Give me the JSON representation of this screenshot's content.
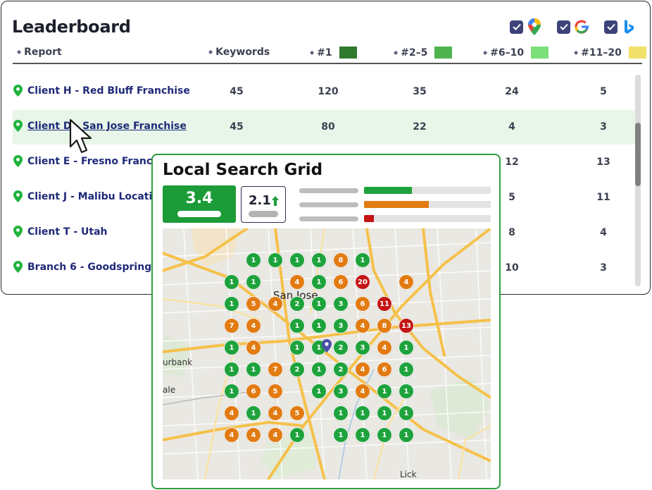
{
  "leaderboard": {
    "title": "Leaderboard",
    "sources": [
      {
        "name": "google-maps",
        "checked": true
      },
      {
        "name": "google",
        "checked": true
      },
      {
        "name": "bing",
        "checked": true
      }
    ],
    "columns": [
      {
        "label": "Report"
      },
      {
        "label": "Keywords"
      },
      {
        "label": "#1",
        "swatch": "#2f7a2f"
      },
      {
        "label": "#2–5",
        "swatch": "#4fb44f"
      },
      {
        "label": "#6–10",
        "swatch": "#7ddf79"
      },
      {
        "label": "#11–20",
        "swatch": "#f2e16b"
      }
    ],
    "rows": [
      {
        "name": "Client H - Red Bluff Franchise",
        "keywords": "45",
        "r1": "120",
        "r2_5": "35",
        "r6_10": "24",
        "r11_20": "5",
        "highlighted": false
      },
      {
        "name": "Client D - San Jose Franchise",
        "keywords": "45",
        "r1": "80",
        "r2_5": "22",
        "r6_10": "4",
        "r11_20": "3",
        "highlighted": true
      },
      {
        "name": "Client E - Fresno Franchise",
        "keywords": "",
        "r1": "",
        "r2_5": "",
        "r6_10": "12",
        "r11_20": "13",
        "highlighted": false
      },
      {
        "name": "Client J - Malibu Location",
        "keywords": "",
        "r1": "",
        "r2_5": "",
        "r6_10": "5",
        "r11_20": "11",
        "highlighted": false
      },
      {
        "name": "Client T - Utah",
        "keywords": "",
        "r1": "",
        "r2_5": "",
        "r6_10": "8",
        "r11_20": "4",
        "highlighted": false
      },
      {
        "name": "Branch 6 - Goodspring",
        "keywords": "",
        "r1": "",
        "r2_5": "",
        "r6_10": "10",
        "r11_20": "3",
        "highlighted": false
      }
    ]
  },
  "grid": {
    "title": "Local Search Grid",
    "score": "3.4",
    "score_secondary": "2.1",
    "trend": "up",
    "distribution": [
      {
        "fill": 0.38,
        "color": "#1ea33c"
      },
      {
        "fill": 0.51,
        "color": "#e27b12"
      },
      {
        "fill": 0.08,
        "color": "#c41414"
      }
    ],
    "map_labels": {
      "city": "San Jose",
      "west": "urbank",
      "west2": "ale",
      "south": "Lick"
    },
    "dots": [
      {
        "row": 0,
        "col": 1,
        "v": "1",
        "c": "g"
      },
      {
        "row": 0,
        "col": 2,
        "v": "1",
        "c": "g"
      },
      {
        "row": 0,
        "col": 3,
        "v": "1",
        "c": "g"
      },
      {
        "row": 0,
        "col": 4,
        "v": "1",
        "c": "g"
      },
      {
        "row": 0,
        "col": 5,
        "v": "8",
        "c": "o"
      },
      {
        "row": 0,
        "col": 6,
        "v": "1",
        "c": "g"
      },
      {
        "row": 1,
        "col": 0,
        "v": "1",
        "c": "g"
      },
      {
        "row": 1,
        "col": 1,
        "v": "1",
        "c": "g"
      },
      {
        "row": 1,
        "col": 3,
        "v": "4",
        "c": "o"
      },
      {
        "row": 1,
        "col": 4,
        "v": "1",
        "c": "g"
      },
      {
        "row": 1,
        "col": 5,
        "v": "6",
        "c": "o"
      },
      {
        "row": 1,
        "col": 6,
        "v": "20",
        "c": "r"
      },
      {
        "row": 1,
        "col": 8,
        "v": "4",
        "c": "o"
      },
      {
        "row": 2,
        "col": 0,
        "v": "1",
        "c": "g"
      },
      {
        "row": 2,
        "col": 1,
        "v": "5",
        "c": "o"
      },
      {
        "row": 2,
        "col": 2,
        "v": "4",
        "c": "o"
      },
      {
        "row": 2,
        "col": 3,
        "v": "2",
        "c": "g"
      },
      {
        "row": 2,
        "col": 4,
        "v": "1",
        "c": "g"
      },
      {
        "row": 2,
        "col": 5,
        "v": "3",
        "c": "g"
      },
      {
        "row": 2,
        "col": 6,
        "v": "6",
        "c": "o"
      },
      {
        "row": 2,
        "col": 7,
        "v": "11",
        "c": "r"
      },
      {
        "row": 3,
        "col": 0,
        "v": "7",
        "c": "o"
      },
      {
        "row": 3,
        "col": 1,
        "v": "4",
        "c": "o"
      },
      {
        "row": 3,
        "col": 3,
        "v": "1",
        "c": "g"
      },
      {
        "row": 3,
        "col": 4,
        "v": "1",
        "c": "g"
      },
      {
        "row": 3,
        "col": 5,
        "v": "3",
        "c": "g"
      },
      {
        "row": 3,
        "col": 6,
        "v": "4",
        "c": "o"
      },
      {
        "row": 3,
        "col": 7,
        "v": "8",
        "c": "o"
      },
      {
        "row": 3,
        "col": 8,
        "v": "13",
        "c": "r"
      },
      {
        "row": 4,
        "col": 0,
        "v": "1",
        "c": "g"
      },
      {
        "row": 4,
        "col": 1,
        "v": "4",
        "c": "o"
      },
      {
        "row": 4,
        "col": 3,
        "v": "1",
        "c": "g"
      },
      {
        "row": 4,
        "col": 4,
        "v": "1",
        "c": "g"
      },
      {
        "row": 4,
        "col": 5,
        "v": "2",
        "c": "g"
      },
      {
        "row": 4,
        "col": 6,
        "v": "3",
        "c": "g"
      },
      {
        "row": 4,
        "col": 7,
        "v": "4",
        "c": "o"
      },
      {
        "row": 4,
        "col": 8,
        "v": "1",
        "c": "g"
      },
      {
        "row": 5,
        "col": 0,
        "v": "1",
        "c": "g"
      },
      {
        "row": 5,
        "col": 1,
        "v": "1",
        "c": "g"
      },
      {
        "row": 5,
        "col": 2,
        "v": "7",
        "c": "o"
      },
      {
        "row": 5,
        "col": 3,
        "v": "2",
        "c": "g"
      },
      {
        "row": 5,
        "col": 4,
        "v": "1",
        "c": "g"
      },
      {
        "row": 5,
        "col": 5,
        "v": "2",
        "c": "g"
      },
      {
        "row": 5,
        "col": 6,
        "v": "4",
        "c": "o"
      },
      {
        "row": 5,
        "col": 7,
        "v": "6",
        "c": "o"
      },
      {
        "row": 5,
        "col": 8,
        "v": "1",
        "c": "g"
      },
      {
        "row": 6,
        "col": 0,
        "v": "1",
        "c": "g"
      },
      {
        "row": 6,
        "col": 1,
        "v": "6",
        "c": "o"
      },
      {
        "row": 6,
        "col": 2,
        "v": "5",
        "c": "o"
      },
      {
        "row": 6,
        "col": 4,
        "v": "1",
        "c": "g"
      },
      {
        "row": 6,
        "col": 5,
        "v": "3",
        "c": "g"
      },
      {
        "row": 6,
        "col": 6,
        "v": "4",
        "c": "o"
      },
      {
        "row": 6,
        "col": 7,
        "v": "1",
        "c": "g"
      },
      {
        "row": 6,
        "col": 8,
        "v": "1",
        "c": "g"
      },
      {
        "row": 7,
        "col": 0,
        "v": "4",
        "c": "o"
      },
      {
        "row": 7,
        "col": 1,
        "v": "1",
        "c": "g"
      },
      {
        "row": 7,
        "col": 2,
        "v": "4",
        "c": "o"
      },
      {
        "row": 7,
        "col": 3,
        "v": "5",
        "c": "o"
      },
      {
        "row": 7,
        "col": 5,
        "v": "1",
        "c": "g"
      },
      {
        "row": 7,
        "col": 6,
        "v": "1",
        "c": "g"
      },
      {
        "row": 7,
        "col": 7,
        "v": "1",
        "c": "g"
      },
      {
        "row": 7,
        "col": 8,
        "v": "1",
        "c": "g"
      },
      {
        "row": 8,
        "col": 0,
        "v": "4",
        "c": "o"
      },
      {
        "row": 8,
        "col": 1,
        "v": "4",
        "c": "o"
      },
      {
        "row": 8,
        "col": 2,
        "v": "4",
        "c": "o"
      },
      {
        "row": 8,
        "col": 3,
        "v": "1",
        "c": "g"
      },
      {
        "row": 8,
        "col": 5,
        "v": "1",
        "c": "g"
      },
      {
        "row": 8,
        "col": 6,
        "v": "1",
        "c": "g"
      },
      {
        "row": 8,
        "col": 7,
        "v": "1",
        "c": "g"
      },
      {
        "row": 8,
        "col": 8,
        "v": "1",
        "c": "g"
      }
    ]
  }
}
